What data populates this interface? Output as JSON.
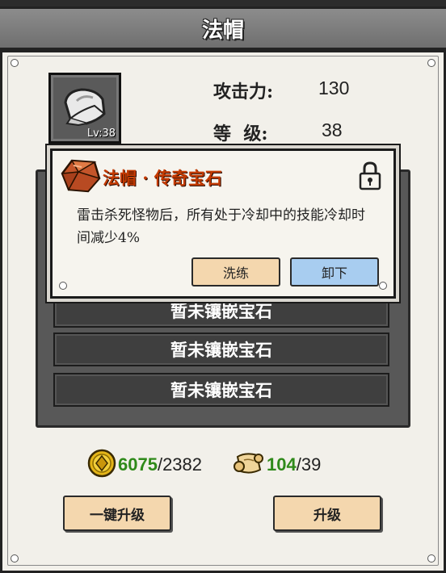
{
  "header": {
    "title": "法帽"
  },
  "item": {
    "level_badge": "Lv:38"
  },
  "stats": {
    "attack_label": "攻击力:",
    "attack_value": "130",
    "level_label": "等  级:",
    "level_value": "38"
  },
  "gem_popup": {
    "title": "法帽 · 传奇宝石",
    "description": "雷击杀死怪物后，所有处于冷却中的技能冷却时间减少4%",
    "wash_label": "洗练",
    "remove_label": "卸下"
  },
  "slots": [
    {
      "label": "暂未镶嵌宝石"
    },
    {
      "label": "暂未镶嵌宝石"
    },
    {
      "label": "暂未镶嵌宝石"
    }
  ],
  "resources": {
    "gold_have": "6075",
    "gold_need": "/2382",
    "scroll_have": "104",
    "scroll_need": "/39"
  },
  "buttons": {
    "upgrade_all": "一键升级",
    "upgrade": "升级"
  },
  "colors": {
    "gem_title": "#c43a00",
    "have_amount": "#2f8a1a",
    "wash_button": "#f4d7ae",
    "remove_button": "#a8cdf0"
  },
  "icons": {
    "item": "hat-item-icon",
    "gem": "orange-gem-icon",
    "lock": "lock-icon",
    "gold": "gold-coin-icon",
    "scroll": "scroll-icon"
  }
}
